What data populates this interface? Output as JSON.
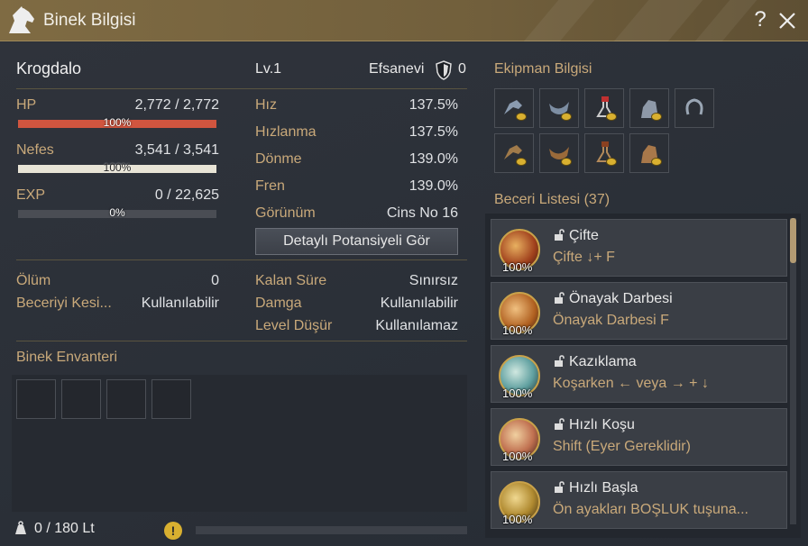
{
  "window": {
    "title": "Binek Bilgisi",
    "help_label": "?"
  },
  "mount": {
    "name": "Krogdalo",
    "level": "Lv.1",
    "grade": "Efsanevi",
    "grade_value": "0"
  },
  "stats": {
    "hp": {
      "label": "HP",
      "value": "2,772 / 2,772",
      "pct": "100%",
      "fill": 1.0
    },
    "stamina": {
      "label": "Nefes",
      "value": "3,541 / 3,541",
      "pct": "100%",
      "fill": 1.0
    },
    "exp": {
      "label": "EXP",
      "value": "0 / 22,625",
      "pct": "0%",
      "fill": 0.0
    }
  },
  "attributes": [
    {
      "label": "Hız",
      "value": "137.5%"
    },
    {
      "label": "Hızlanma",
      "value": "137.5%"
    },
    {
      "label": "Dönme",
      "value": "139.0%"
    },
    {
      "label": "Fren",
      "value": "139.0%"
    },
    {
      "label": "Görünüm",
      "value": "Cins No 16"
    }
  ],
  "potential_button": "Detaylı Potansiyeli Gör",
  "info_left": [
    {
      "label": "Ölüm",
      "value": "0"
    },
    {
      "label": "Beceriyi Kesi...",
      "value": "Kullanılabilir"
    }
  ],
  "info_right": [
    {
      "label": "Kalan Süre",
      "value": "Sınırsız"
    },
    {
      "label": "Damga",
      "value": "Kullanılabilir"
    },
    {
      "label": "Level Düşür",
      "value": "Kullanılamaz"
    }
  ],
  "inventory": {
    "title": "Binek Envanteri",
    "weight": "0 / 180 Lt",
    "warning": "!"
  },
  "equipment": {
    "title": "Ekipman Bilgisi"
  },
  "skills": {
    "title": "Beceri Listesi (37)",
    "items": [
      {
        "name": "Çifte",
        "cmd": "Çifte ↓+ F",
        "pct": "100%"
      },
      {
        "name": "Önayak Darbesi",
        "cmd": "Önayak Darbesi F",
        "pct": "100%"
      },
      {
        "name": "Kazıklama",
        "cmd": "Koşarken ← veya → + ↓",
        "pct": "100%"
      },
      {
        "name": "Hızlı Koşu",
        "cmd": "Shift (Eyer Gereklidir)",
        "pct": "100%"
      },
      {
        "name": "Hızlı Başla",
        "cmd": "Ön ayakları BOŞLUK tuşuna...",
        "pct": "100%"
      }
    ]
  },
  "colors": {
    "accent": "#c9a97a",
    "hp": "#d0553f",
    "stamina": "#e8e4d6",
    "title_bar": "#7f6b43"
  }
}
